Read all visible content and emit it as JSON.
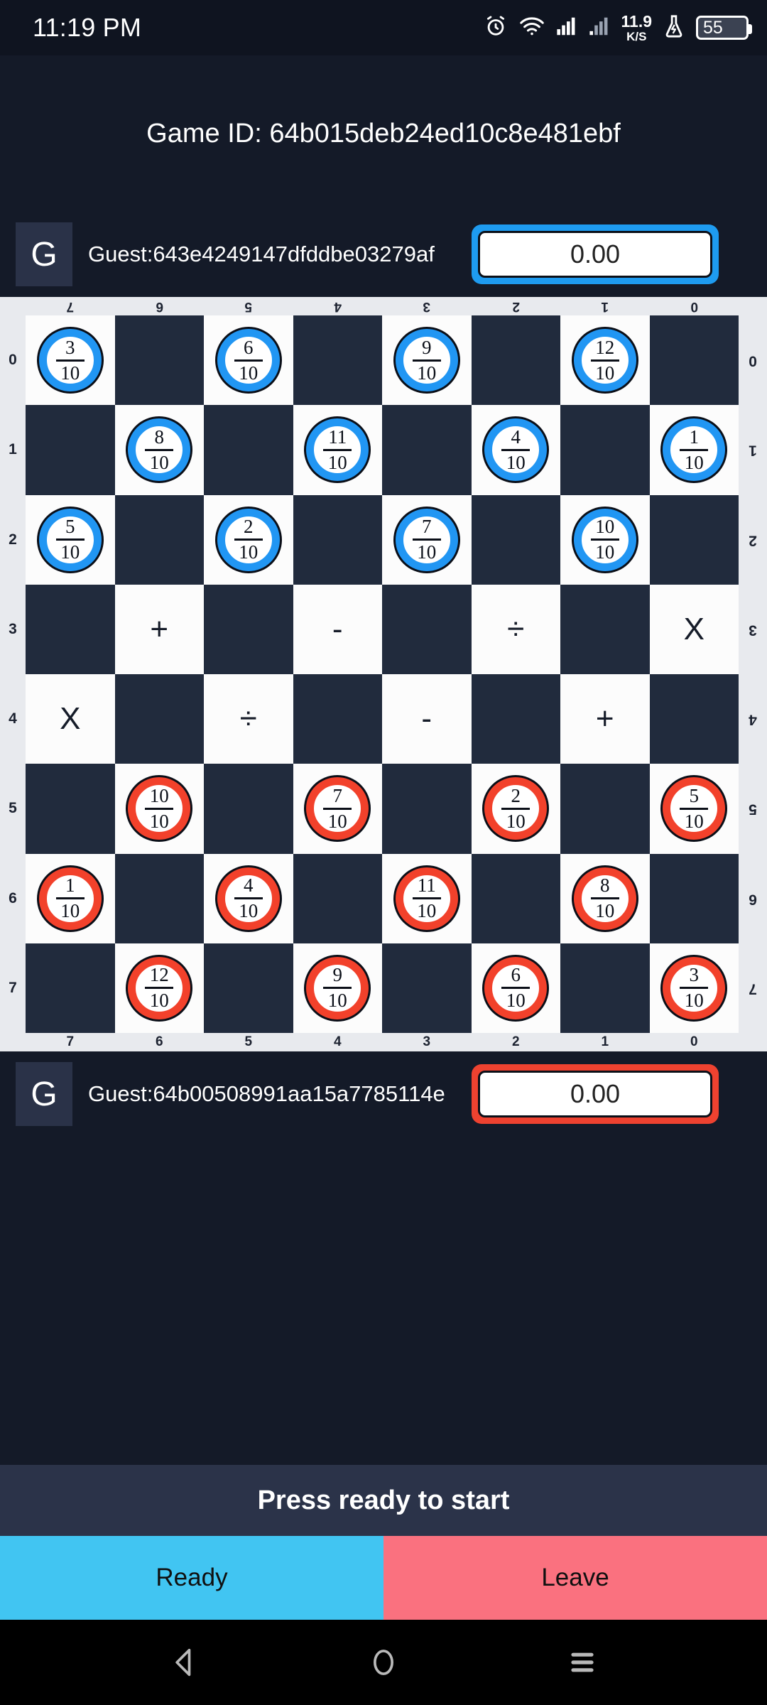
{
  "status_bar": {
    "time": "11:19 PM",
    "net_speed_value": "11.9",
    "net_speed_unit": "K/S",
    "battery_level": "55",
    "icons": [
      "alarm-icon",
      "wifi-icon",
      "signal-icon-1",
      "signal-icon-2",
      "flask-icon",
      "battery-icon"
    ]
  },
  "header": {
    "game_id_label": "Game ID: 64b015deb24ed10c8e481ebf"
  },
  "top_player": {
    "avatar_initial": "G",
    "name": "Guest:643e4249147dfddbe03279af",
    "score": "0.00",
    "accent": "#1E9BF0"
  },
  "bottom_player": {
    "avatar_initial": "G",
    "name": "Guest:64b00508991aa15a7785114e",
    "score": "0.00",
    "accent": "#EE4230"
  },
  "board": {
    "top_labels": [
      "7",
      "6",
      "5",
      "4",
      "3",
      "2",
      "1",
      "0"
    ],
    "bottom_labels": [
      "7",
      "6",
      "5",
      "4",
      "3",
      "2",
      "1",
      "0"
    ],
    "left_labels": [
      "0",
      "1",
      "2",
      "3",
      "4",
      "5",
      "6",
      "7"
    ],
    "right_labels": [
      "0",
      "1",
      "2",
      "3",
      "4",
      "5",
      "6",
      "7"
    ],
    "light_color": "#FCFCFC",
    "dark_color": "#212B3D",
    "blue_piece_color": "#2196F3",
    "red_piece_color": "#F2412B",
    "denominator": "10",
    "rows": [
      [
        {
          "type": "piece",
          "color": "blue",
          "num": "3",
          "den": "10"
        },
        {
          "type": "empty"
        },
        {
          "type": "piece",
          "color": "blue",
          "num": "6",
          "den": "10"
        },
        {
          "type": "empty"
        },
        {
          "type": "piece",
          "color": "blue",
          "num": "9",
          "den": "10"
        },
        {
          "type": "empty"
        },
        {
          "type": "piece",
          "color": "blue",
          "num": "12",
          "den": "10"
        },
        {
          "type": "empty"
        }
      ],
      [
        {
          "type": "empty"
        },
        {
          "type": "piece",
          "color": "blue",
          "num": "8",
          "den": "10"
        },
        {
          "type": "empty"
        },
        {
          "type": "piece",
          "color": "blue",
          "num": "11",
          "den": "10"
        },
        {
          "type": "empty"
        },
        {
          "type": "piece",
          "color": "blue",
          "num": "4",
          "den": "10"
        },
        {
          "type": "empty"
        },
        {
          "type": "piece",
          "color": "blue",
          "num": "1",
          "den": "10"
        }
      ],
      [
        {
          "type": "piece",
          "color": "blue",
          "num": "5",
          "den": "10"
        },
        {
          "type": "empty"
        },
        {
          "type": "piece",
          "color": "blue",
          "num": "2",
          "den": "10"
        },
        {
          "type": "empty"
        },
        {
          "type": "piece",
          "color": "blue",
          "num": "7",
          "den": "10"
        },
        {
          "type": "empty"
        },
        {
          "type": "piece",
          "color": "blue",
          "num": "10",
          "den": "10"
        },
        {
          "type": "empty"
        }
      ],
      [
        {
          "type": "empty"
        },
        {
          "type": "operator",
          "symbol": "+"
        },
        {
          "type": "empty"
        },
        {
          "type": "operator",
          "symbol": "-"
        },
        {
          "type": "empty"
        },
        {
          "type": "operator",
          "symbol": "÷"
        },
        {
          "type": "empty"
        },
        {
          "type": "operator",
          "symbol": "X"
        }
      ],
      [
        {
          "type": "operator",
          "symbol": "X"
        },
        {
          "type": "empty"
        },
        {
          "type": "operator",
          "symbol": "÷"
        },
        {
          "type": "empty"
        },
        {
          "type": "operator",
          "symbol": "-"
        },
        {
          "type": "empty"
        },
        {
          "type": "operator",
          "symbol": "+"
        },
        {
          "type": "empty"
        }
      ],
      [
        {
          "type": "empty"
        },
        {
          "type": "piece",
          "color": "red",
          "num": "10",
          "den": "10"
        },
        {
          "type": "empty"
        },
        {
          "type": "piece",
          "color": "red",
          "num": "7",
          "den": "10"
        },
        {
          "type": "empty"
        },
        {
          "type": "piece",
          "color": "red",
          "num": "2",
          "den": "10"
        },
        {
          "type": "empty"
        },
        {
          "type": "piece",
          "color": "red",
          "num": "5",
          "den": "10"
        }
      ],
      [
        {
          "type": "piece",
          "color": "red",
          "num": "1",
          "den": "10"
        },
        {
          "type": "empty"
        },
        {
          "type": "piece",
          "color": "red",
          "num": "4",
          "den": "10"
        },
        {
          "type": "empty"
        },
        {
          "type": "piece",
          "color": "red",
          "num": "11",
          "den": "10"
        },
        {
          "type": "empty"
        },
        {
          "type": "piece",
          "color": "red",
          "num": "8",
          "den": "10"
        },
        {
          "type": "empty"
        }
      ],
      [
        {
          "type": "empty"
        },
        {
          "type": "piece",
          "color": "red",
          "num": "12",
          "den": "10"
        },
        {
          "type": "empty"
        },
        {
          "type": "piece",
          "color": "red",
          "num": "9",
          "den": "10"
        },
        {
          "type": "empty"
        },
        {
          "type": "piece",
          "color": "red",
          "num": "6",
          "den": "10"
        },
        {
          "type": "empty"
        },
        {
          "type": "piece",
          "color": "red",
          "num": "3",
          "den": "10"
        }
      ]
    ]
  },
  "footer": {
    "banner_text": "Press ready to start",
    "ready_label": "Ready",
    "leave_label": "Leave",
    "ready_color": "#41C5F2",
    "leave_color": "#FA717F"
  },
  "navbar": {
    "back": "back-icon",
    "home": "home-icon",
    "recents": "recents-icon"
  }
}
